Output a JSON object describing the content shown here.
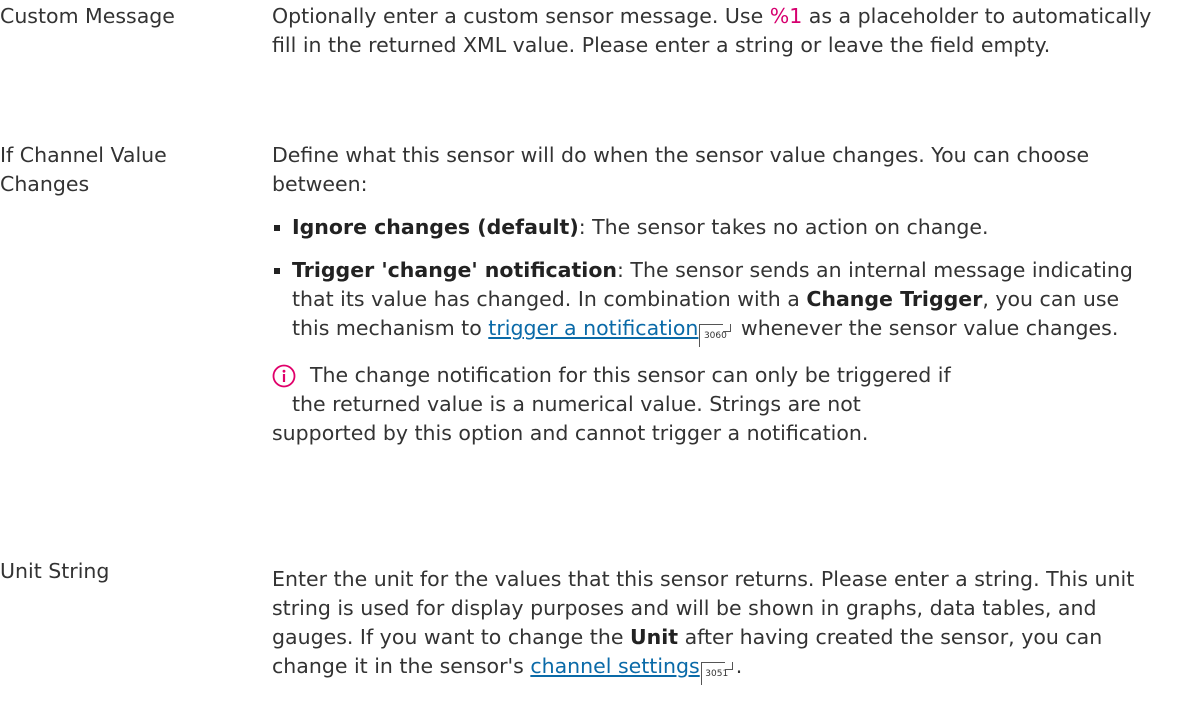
{
  "rows": [
    {
      "label": "Custom Message",
      "text_before": "Optionally enter a custom sensor message. Use ",
      "highlight": "%1",
      "text_after": " as a placeholder to automatically fill in the returned XML value. Please enter a string or leave the field empty."
    },
    {
      "label_line1": "If Channel Value",
      "label_line2": "Changes",
      "intro": "Define what this sensor will do when the sensor value changes. You can choose between:",
      "options": [
        {
          "term": "Ignore changes (default)",
          "text": ": The sensor takes no action on change."
        },
        {
          "term": "Trigger 'change' notification",
          "text_a": ": The sensor sends an internal message indicating that its value has changed. In combination with a ",
          "bold": "Change Trigger",
          "text_b": ", you can use this mechanism to ",
          "link": "trigger a notification",
          "ref": "3060",
          "text_c": " whenever the sensor value changes."
        }
      ],
      "note_line1": "The change notification for this sensor can only be triggered if",
      "note_line2": "the returned value is a numerical value. Strings are not",
      "note_line3": "supported by this option and cannot trigger a notification.",
      "note_icon": "info-icon",
      "note_icon_color": "#e0006a"
    },
    {
      "label": "Unit String",
      "text_a": "Enter the unit for the values that this sensor returns.  Please enter a string. This unit string is used for display purposes and will be shown in graphs, data tables, and gauges. If you want to change the ",
      "bold": "Unit",
      "text_b": " after having created the sensor, you can change it in the sensor's ",
      "link": "channel settings",
      "ref": "3051",
      "text_c": "."
    }
  ]
}
